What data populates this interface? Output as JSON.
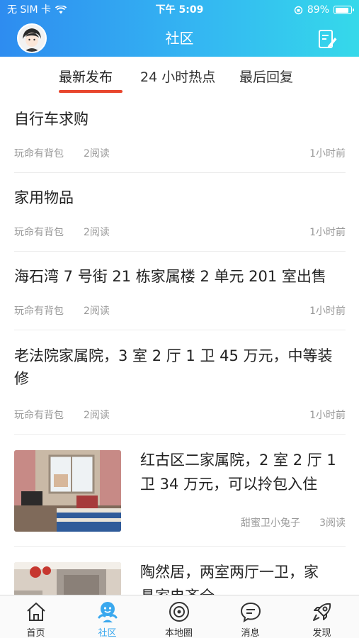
{
  "status_bar": {
    "carrier": "无 SIM 卡",
    "time": "下午 5:09",
    "battery_text": "89%",
    "battery_level": 0.89
  },
  "header": {
    "title": "社区"
  },
  "tabs": [
    {
      "label": "最新发布",
      "active": true
    },
    {
      "label": "24 小时热点",
      "active": false
    },
    {
      "label": "最后回复",
      "active": false
    }
  ],
  "posts": [
    {
      "title": "自行车求购",
      "author": "玩命有背包",
      "reads": "2阅读",
      "time": "1小时前"
    },
    {
      "title": "家用物品",
      "author": "玩命有背包",
      "reads": "2阅读",
      "time": "1小时前"
    },
    {
      "title": "海石湾 7 号街 21 栋家属楼 2 单元 201 室出售",
      "author": "玩命有背包",
      "reads": "2阅读",
      "time": "1小时前"
    },
    {
      "title_line1": "老法院家属院，3 室 2 厅 1 卫 45 万元，中等装",
      "title_line2": "修",
      "author": "玩命有背包",
      "reads": "2阅读",
      "time": "1小时前"
    },
    {
      "title_line1": "红古区二家属院，2 室 2 厅 1",
      "title_line2": "卫 34 万元，可以拎包入住",
      "author": "甜蜜卫小兔子",
      "reads": "3阅读"
    },
    {
      "title_line1": "陶然居，两室两厅一卫，家",
      "title_line2": "具家电齐全"
    }
  ],
  "tabbar": [
    {
      "label": "首页",
      "icon": "home-icon"
    },
    {
      "label": "社区",
      "icon": "community-icon",
      "active": true
    },
    {
      "label": "本地圈",
      "icon": "local-circle-icon"
    },
    {
      "label": "消息",
      "icon": "message-icon"
    },
    {
      "label": "发现",
      "icon": "rocket-icon"
    }
  ],
  "colors": {
    "accent": "#e8462d",
    "header_start": "#2e8cf0",
    "header_end": "#35d9ea",
    "tab_active": "#3aa8ee"
  }
}
